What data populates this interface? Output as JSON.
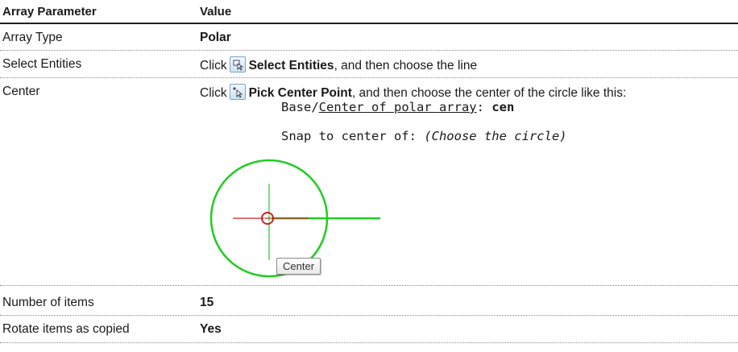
{
  "headers": {
    "param": "Array Parameter",
    "value": "Value"
  },
  "rows": [
    {
      "param": "Array Type",
      "value": "Polar"
    },
    {
      "param": "Select Entities",
      "prefix": "Click",
      "label": "Select Entities",
      "suffix": ", and then choose the line",
      "icon": "select-entities-icon"
    },
    {
      "param": "Center",
      "prefix": "Click",
      "label": "Pick Center Point",
      "suffix": ", and then choose the center of the circle like this:",
      "icon": "pick-center-point-icon",
      "command": {
        "line1_prefix": "Base/",
        "line1_underlined": "Center of polar array",
        "line1_sep": ": ",
        "line1_input": "cen",
        "line2_prefix": "Snap to center of: ",
        "line2_italic": "(Choose the circle)"
      },
      "tooltip": "Center"
    },
    {
      "param": "Number of items",
      "value": "15"
    },
    {
      "param": "Rotate items as copied",
      "value": "Yes"
    }
  ],
  "colors": {
    "circle": "#22cc22",
    "crosshair_horizontal": "#cc2222",
    "crosshair_vertical": "#22cc22",
    "snap_marker": "#cc2222"
  }
}
